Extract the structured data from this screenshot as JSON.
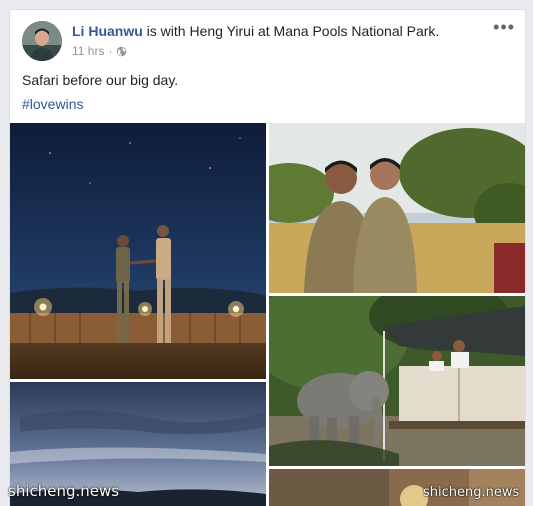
{
  "post": {
    "author": "Li Huanwu",
    "with_text": " is with ",
    "tagged": "Heng Yirui",
    "at_text": " at ",
    "location": "Mana Pools National Park",
    "end_punct": ".",
    "timestamp": "11 hrs",
    "separator": "·",
    "caption": "Safari before our big day.",
    "hashtag": "#lovewins",
    "more_label": "•••"
  },
  "icons": {
    "privacy": "globe-icon",
    "options": "more-options-icon"
  },
  "colors": {
    "link": "#365899",
    "text": "#1d2129",
    "meta": "#90949c",
    "background": "#e9ebee"
  },
  "watermarks": {
    "left": "shicheng.news",
    "right": "shicheng.news"
  }
}
